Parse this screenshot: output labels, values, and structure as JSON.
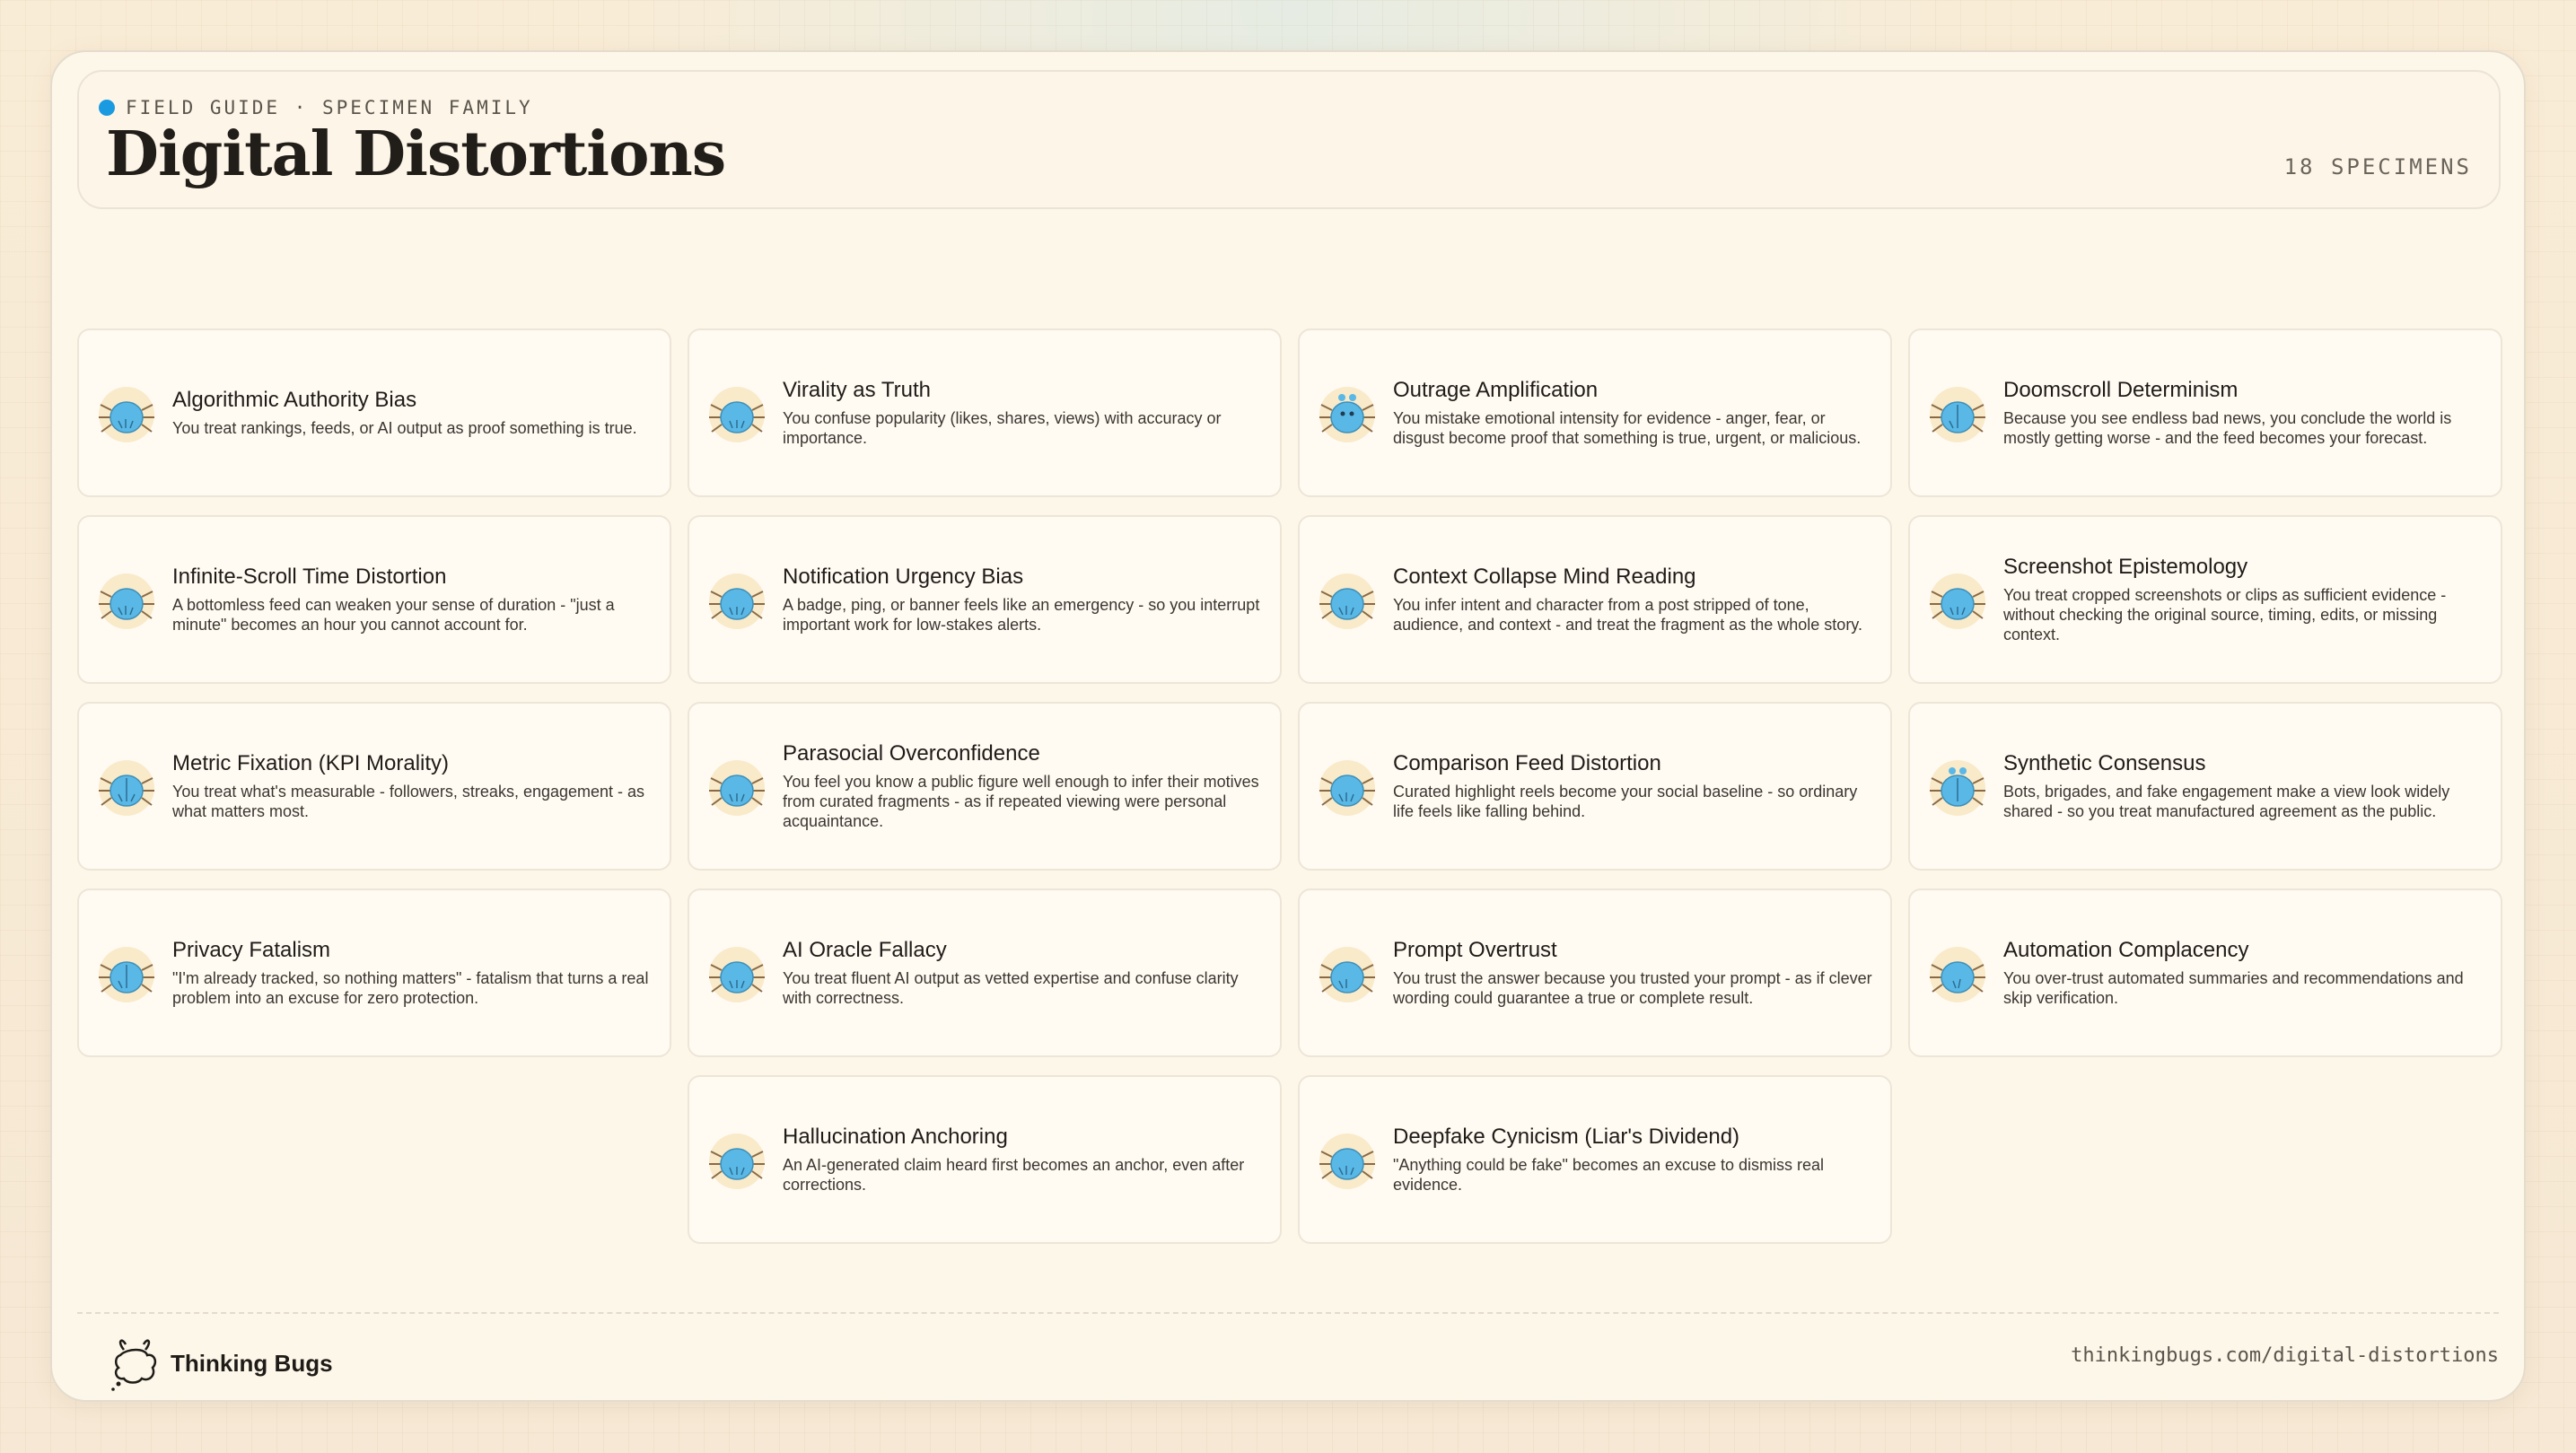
{
  "header": {
    "eyebrow": "FIELD GUIDE · SPECIMEN FAMILY",
    "title": "Digital Distortions",
    "count": "18 SPECIMENS"
  },
  "specimens": [
    {
      "name": "Algorithmic Authority Bias",
      "desc": "You treat rankings, feeds, or AI output as proof something is true."
    },
    {
      "name": "Virality as Truth",
      "desc": "You confuse popularity (likes, shares, views) with accuracy or importance."
    },
    {
      "name": "Outrage Amplification",
      "desc": "You mistake emotional intensity for evidence - anger, fear, or disgust become proof that something is true, urgent, or malicious."
    },
    {
      "name": "Doomscroll Determinism",
      "desc": "Because you see endless bad news, you conclude the world is mostly getting worse - and the feed becomes your forecast."
    },
    {
      "name": "Infinite-Scroll Time Distortion",
      "desc": "A bottomless feed can weaken your sense of duration - \"just a minute\" becomes an hour you cannot account for."
    },
    {
      "name": "Notification Urgency Bias",
      "desc": "A badge, ping, or banner feels like an emergency - so you interrupt important work for low-stakes alerts."
    },
    {
      "name": "Context Collapse Mind Reading",
      "desc": "You infer intent and character from a post stripped of tone, audience, and context - and treat the fragment as the whole story."
    },
    {
      "name": "Screenshot Epistemology",
      "desc": "You treat cropped screenshots or clips as sufficient evidence - without checking the original source, timing, edits, or missing context."
    },
    {
      "name": "Metric Fixation (KPI Morality)",
      "desc": "You treat what's measurable - followers, streaks, engagement - as what matters most."
    },
    {
      "name": "Parasocial Overconfidence",
      "desc": "You feel you know a public figure well enough to infer their motives from curated fragments - as if repeated viewing were personal acquaintance."
    },
    {
      "name": "Comparison Feed Distortion",
      "desc": "Curated highlight reels become your social baseline - so ordinary life feels like falling behind."
    },
    {
      "name": "Synthetic Consensus",
      "desc": "Bots, brigades, and fake engagement make a view look widely shared - so you treat manufactured agreement as the public."
    },
    {
      "name": "Privacy Fatalism",
      "desc": "\"I'm already tracked, so nothing matters\" - fatalism that turns a real problem into an excuse for zero protection."
    },
    {
      "name": "AI Oracle Fallacy",
      "desc": "You treat fluent AI output as vetted expertise and confuse clarity with correctness."
    },
    {
      "name": "Prompt Overtrust",
      "desc": "You trust the answer because you trusted your prompt - as if clever wording could guarantee a true or complete result."
    },
    {
      "name": "Automation Complacency",
      "desc": "You over-trust automated summaries and recommendations and skip verification."
    },
    {
      "name": "Hallucination Anchoring",
      "desc": "An AI-generated claim heard first becomes an anchor, even after corrections."
    },
    {
      "name": "Deepfake Cynicism (Liar's Dividend)",
      "desc": "\"Anything could be fake\" becomes an excuse to dismiss real evidence."
    }
  ],
  "footer": {
    "brand": "Thinking Bugs",
    "url": "thinkingbugs.com/digital-distortions"
  },
  "colors": {
    "accent": "#1a9ae0",
    "bug_body": "#5ab8e6",
    "bug_halo": "#f6e3b8"
  },
  "icons": {
    "eyebrow": "dot-icon",
    "specimen": "bug-icon",
    "brand": "thinking-bug-logo-icon"
  }
}
